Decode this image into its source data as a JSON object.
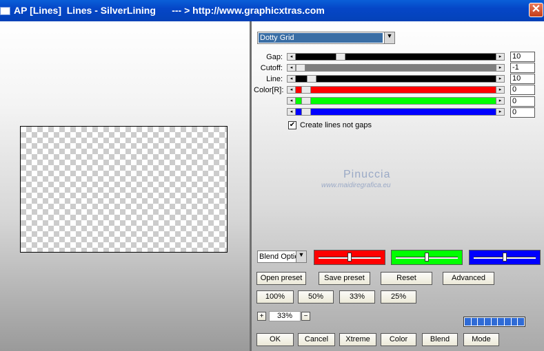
{
  "window": {
    "title": "AP [Lines]  Lines - SilverLining      --- > http://www.graphicxtras.com",
    "close_label": "✕"
  },
  "preset": {
    "selected": "Dotty Grid"
  },
  "sliders": {
    "gap": {
      "label": "Gap:",
      "value": "10"
    },
    "cutoff": {
      "label": "Cutoff:",
      "value": "-1"
    },
    "line": {
      "label": "Line:",
      "value": "10"
    },
    "color_r": {
      "label": "Color[R]:",
      "value": "0"
    },
    "color_g": {
      "value": "0"
    },
    "color_b": {
      "value": "0"
    }
  },
  "checkbox": {
    "label": "Create lines not gaps",
    "checked": true
  },
  "watermark": {
    "name": "Pinuccia",
    "url": "www.maidiregrafica.eu"
  },
  "blend": {
    "selected": "Blend Optio"
  },
  "buttons": {
    "open_preset": "Open preset",
    "save_preset": "Save preset",
    "reset": "Reset",
    "advanced": "Advanced",
    "zoom_100": "100%",
    "zoom_50": "50%",
    "zoom_33": "33%",
    "zoom_25": "25%",
    "zoom_plus": "+",
    "zoom_minus": "−",
    "ok": "OK",
    "cancel": "Cancel",
    "xtreme": "Xtreme",
    "color": "Color",
    "blend": "Blend",
    "mode": "Mode"
  },
  "zoom": {
    "value": "33%"
  },
  "colors": {
    "red": "#ff0000",
    "green": "#00ff00",
    "blue": "#0000ff",
    "title_bar": "#0546c7"
  }
}
